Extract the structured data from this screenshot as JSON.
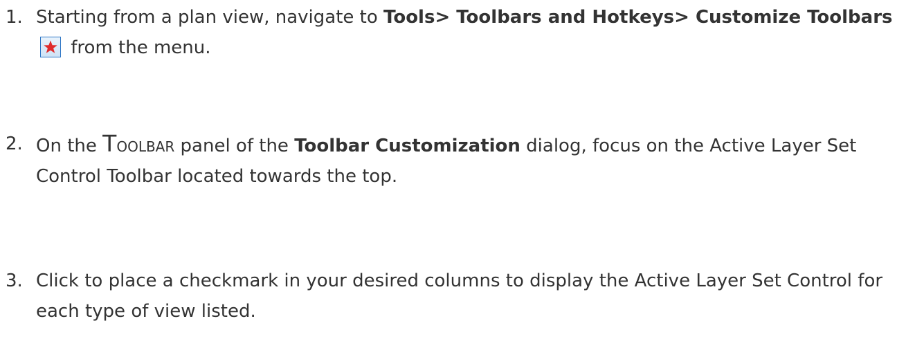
{
  "steps": [
    {
      "number": "1.",
      "text_before": "Starting from a plan view, navigate to ",
      "bold_path": "Tools> Toolbars and Hotkeys> Customize Toolbars",
      "icon": "star-icon",
      "text_after": " from the menu."
    },
    {
      "number": "2.",
      "text_before": "On the ",
      "panel_cap": "T",
      "panel_rest": "oolbar",
      "text_middle": " panel of the ",
      "bold_dialog": "Toolbar Customization",
      "text_after": " dialog, focus on the Active Layer Set Control Toolbar located towards the top."
    },
    {
      "number": "3.",
      "text": "Click to place a checkmark in your desired columns to display the Active Layer Set Control for each type of view listed."
    }
  ],
  "colors": {
    "text": "#333333",
    "icon_border": "#2b74c4",
    "icon_star": "#e02b2b"
  }
}
